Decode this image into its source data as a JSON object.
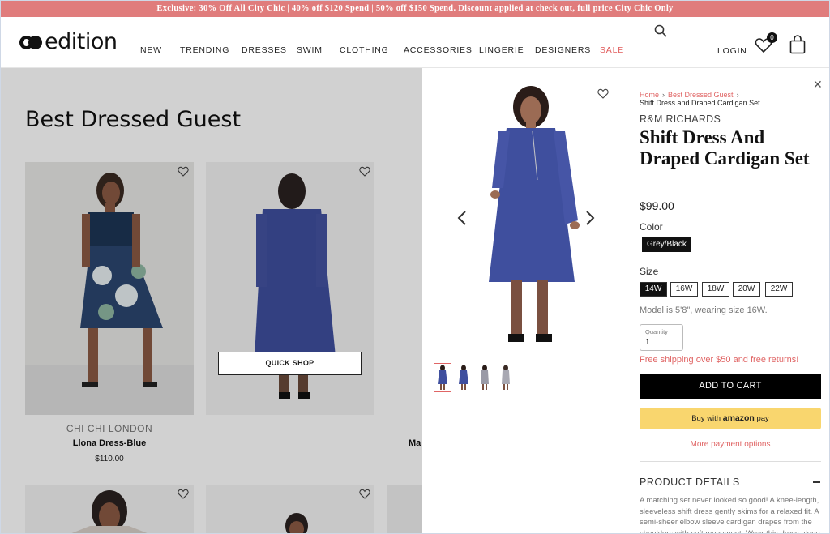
{
  "promo": {
    "text": "Exclusive: 30% Off All City Chic | 40% off $120 Spend | 50% off $150 Spend. Discount applied at check out, full price City Chic Only"
  },
  "header": {
    "logo_text": "edition",
    "nav": [
      "NEW",
      "TRENDING",
      "DRESSES",
      "SWIM",
      "CLOTHING",
      "ACCESSORIES",
      "LINGERIE",
      "DESIGNERS",
      "SALE"
    ],
    "login": "LOGIN",
    "wishlist_count": "0"
  },
  "listing": {
    "title": "Best Dressed Guest",
    "quick_shop": "QUICK SHOP",
    "products": [
      {
        "brand": "CHI CHI LONDON",
        "name": "Llona Dress-Blue",
        "price": "$110.00"
      },
      {
        "brand": "",
        "name": "Ma",
        "price": ""
      }
    ]
  },
  "product": {
    "breadcrumb": [
      "Home",
      "Best Dressed Guest"
    ],
    "breadcrumb_current": "Shift Dress and Draped Cardigan Set",
    "brand": "R&M RICHARDS",
    "title": "Shift Dress And Draped Cardigan Set",
    "price": "$99.00",
    "color_label": "Color",
    "color_value": "Grey/Black",
    "size_label": "Size",
    "sizes": [
      "14W",
      "16W",
      "18W",
      "20W",
      "22W"
    ],
    "selected_size": "14W",
    "model_note": "Model is 5'8\", wearing size 16W.",
    "quantity_label": "Quantity",
    "quantity_value": "1",
    "shipping_note": "Free shipping over $50 and free returns!",
    "add_to_cart": "ADD TO CART",
    "amazon_pay_prefix": "Buy with",
    "amazon_pay_brand": "amazon",
    "amazon_pay_suffix": "pay",
    "more_payment": "More payment options",
    "details_title": "PRODUCT DETAILS",
    "details_text": "A matching set never looked so good! A knee-length, sleeveless shift dress gently skims for a relaxed fit. A semi-sheer elbow sleeve cardigan drapes from the shoulders with soft movement. Wear this dress alone or"
  },
  "colors": {
    "promo_bg": "#e07c7c",
    "accent": "#e06565",
    "dress_blue": "#3f4f9e",
    "amazon_yellow": "#f9d66e"
  }
}
